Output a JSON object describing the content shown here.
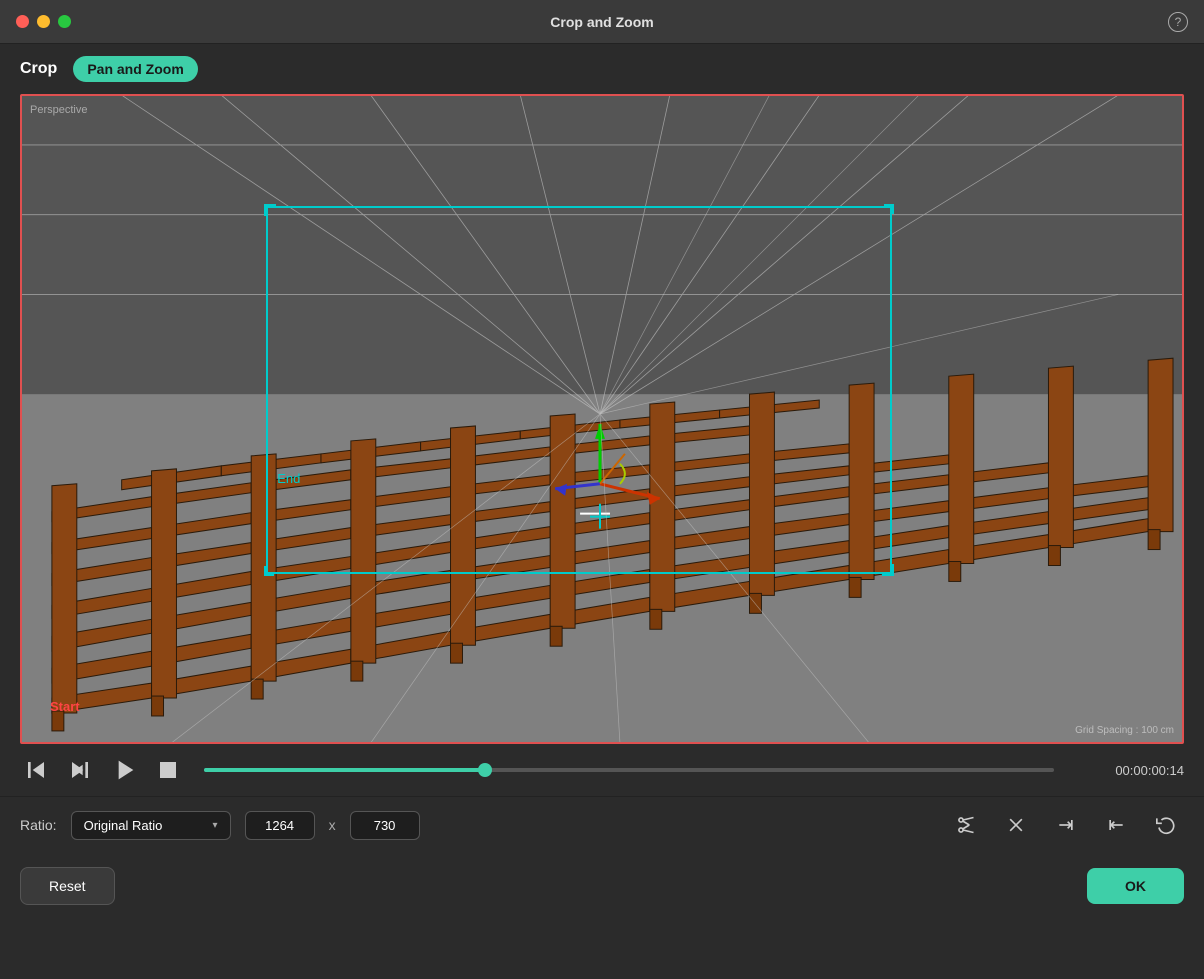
{
  "titlebar": {
    "title": "Crop and Zoom",
    "help_label": "?"
  },
  "tabs": {
    "crop_label": "Crop",
    "panzoom_label": "Pan and Zoom"
  },
  "viewport": {
    "perspective_label": "Perspective",
    "grid_spacing_label": "Grid Spacing : 100 cm",
    "start_label": "Start",
    "end_label": "End"
  },
  "controls": {
    "timecode": "00:00:00:14"
  },
  "ratio_bar": {
    "label": "Ratio:",
    "ratio_value": "Original Ratio",
    "width": "1264",
    "height": "730",
    "x_separator": "x"
  },
  "footer": {
    "reset_label": "Reset",
    "ok_label": "OK"
  },
  "icons": {
    "step_back": "◁|",
    "step_fwd": "▷|",
    "play": "▷",
    "stop": "□",
    "cut": "✂",
    "close": "✕",
    "trim_right": "→|",
    "trim_left": "|←",
    "loop": "⇐"
  }
}
